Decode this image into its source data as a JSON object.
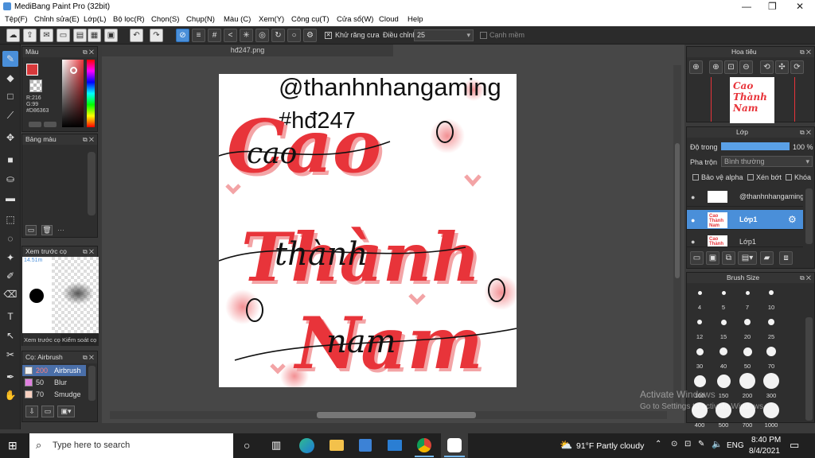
{
  "window": {
    "title": "MediBang Paint Pro (32bit)",
    "minimize": "—",
    "maximize": "❐",
    "close": "✕"
  },
  "menu": [
    "Tệp(F)",
    "Chỉnh sửa(E)",
    "Lớp(L)",
    "Bộ lọc(R)",
    "Chọn(S)",
    "Chụp(N)",
    "Màu (C)",
    "Xem(Y)",
    "Công cụ(T)",
    "Cửa sổ(W)",
    "Cloud",
    "Help"
  ],
  "toolbar": {
    "antialias_label": "Khử răng cưa",
    "adjust_label": "Điều chỉnh",
    "adjust_value": "25",
    "edge_label": "Cạnh mềm"
  },
  "color_panel": {
    "title": "Màu",
    "r": "R:216",
    "g": "G:99",
    "hex": "#D86363",
    "accent": "#D8393B"
  },
  "palette_panel": {
    "title": "Bảng màu",
    "more": "···"
  },
  "preview_panel": {
    "title": "Xem trước cọ",
    "size": "14.51m",
    "tab1": "Xem trước cọ",
    "tab2": "Kiểm soát cọ"
  },
  "brush_list": {
    "title": "Cọ: Airbrush",
    "items": [
      {
        "size": "200",
        "name": "Airbrush",
        "swatch": "#f0f0f0",
        "active": true
      },
      {
        "size": "50",
        "name": "Blur",
        "swatch": "#e080e0",
        "active": false
      },
      {
        "size": "70",
        "name": "Smudge",
        "swatch": "#f8d0c0",
        "active": false
      }
    ]
  },
  "document": {
    "tab": "hđ247.png"
  },
  "artwork": {
    "line1": "@thanhnhangaming",
    "line2": "#hđ247",
    "word1": "Cao",
    "word2": "Thành",
    "word3": "Nam",
    "script1": "cao",
    "script2": "thành",
    "script3": "nam",
    "red": "#e8343a",
    "shadow": "#f3a4a6"
  },
  "navigator": {
    "title": "Hoa tiêu"
  },
  "layer_panel": {
    "title": "Lớp",
    "opacity_label": "Độ trong",
    "opacity_value": "100 %",
    "opacity_fraction": 1.0,
    "blend_label": "Pha trộn",
    "blend_value": "Bình thường",
    "protect_alpha": "Bảo vệ alpha",
    "clip": "Xén bớt",
    "lock": "Khóa",
    "layers": [
      {
        "name": "@thanhnhangaming",
        "active": false
      },
      {
        "name": "Lớp1",
        "active": true
      },
      {
        "name": "Lớp1",
        "active": false
      }
    ]
  },
  "brush_size": {
    "title": "Brush Size",
    "sizes": [
      "4",
      "5",
      "7",
      "10",
      "12",
      "15",
      "20",
      "25",
      "30",
      "40",
      "50",
      "70",
      "100",
      "150",
      "200",
      "300",
      "400",
      "500",
      "700",
      "1000"
    ]
  },
  "watermark": {
    "line1": "Activate Windows",
    "line2": "Go to Settings to activate Windows."
  },
  "taskbar": {
    "search_placeholder": "Type here to search",
    "weather": "91°F  Partly cloudy",
    "lang": "ENG",
    "time": "8:40 PM",
    "date": "8/4/2021"
  }
}
